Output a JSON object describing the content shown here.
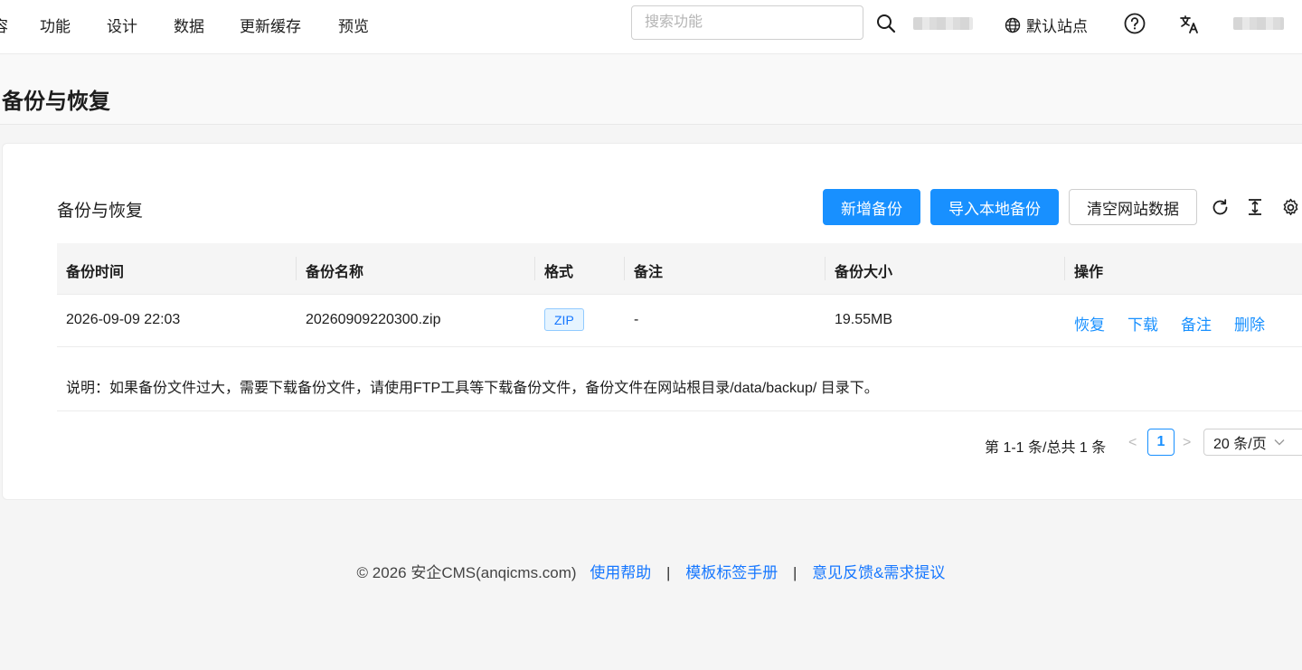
{
  "nav": {
    "items": [
      {
        "label": "容"
      },
      {
        "label": "功能"
      },
      {
        "label": "设计"
      },
      {
        "label": "数据"
      },
      {
        "label": "更新缓存"
      },
      {
        "label": "预览"
      }
    ],
    "search_placeholder": "搜索功能",
    "site_label": "默认站点",
    "icons": [
      "search-icon",
      "globe-icon",
      "help-icon",
      "translate-icon"
    ]
  },
  "page": {
    "title": "备份与恢复"
  },
  "card": {
    "title": "备份与恢复",
    "buttons": {
      "add_backup": "新增备份",
      "import_local": "导入本地备份",
      "clear_data": "清空网站数据"
    },
    "toolbar_icons": [
      "refresh-icon",
      "column-height-icon",
      "settings-icon"
    ]
  },
  "table": {
    "columns": [
      "备份时间",
      "备份名称",
      "格式",
      "备注",
      "备份大小",
      "操作"
    ],
    "rows": [
      {
        "time": "2026-09-09 22:03",
        "name": "20260909220300.zip",
        "format": "ZIP",
        "remark": "-",
        "size": "19.55MB",
        "actions": [
          "恢复",
          "下载",
          "备注",
          "删除"
        ]
      }
    ]
  },
  "note": "说明：如果备份文件过大，需要下载备份文件，请使用FTP工具等下载备份文件，备份文件在网站根目录/data/backup/ 目录下。",
  "pagination": {
    "total_text": "第 1-1 条/总共 1 条",
    "prev": "<",
    "next": ">",
    "current_page": "1",
    "page_size": "20 条/页"
  },
  "footer": {
    "copyright": "© 2026 安企CMS(anqicms.com)",
    "links": [
      "使用帮助",
      "模板标签手册",
      "意见反馈&需求提议"
    ],
    "separator": "|"
  },
  "colors": {
    "primary": "#1890ff",
    "tag_text": "#1677ff",
    "tag_bg": "#e6f4ff"
  }
}
